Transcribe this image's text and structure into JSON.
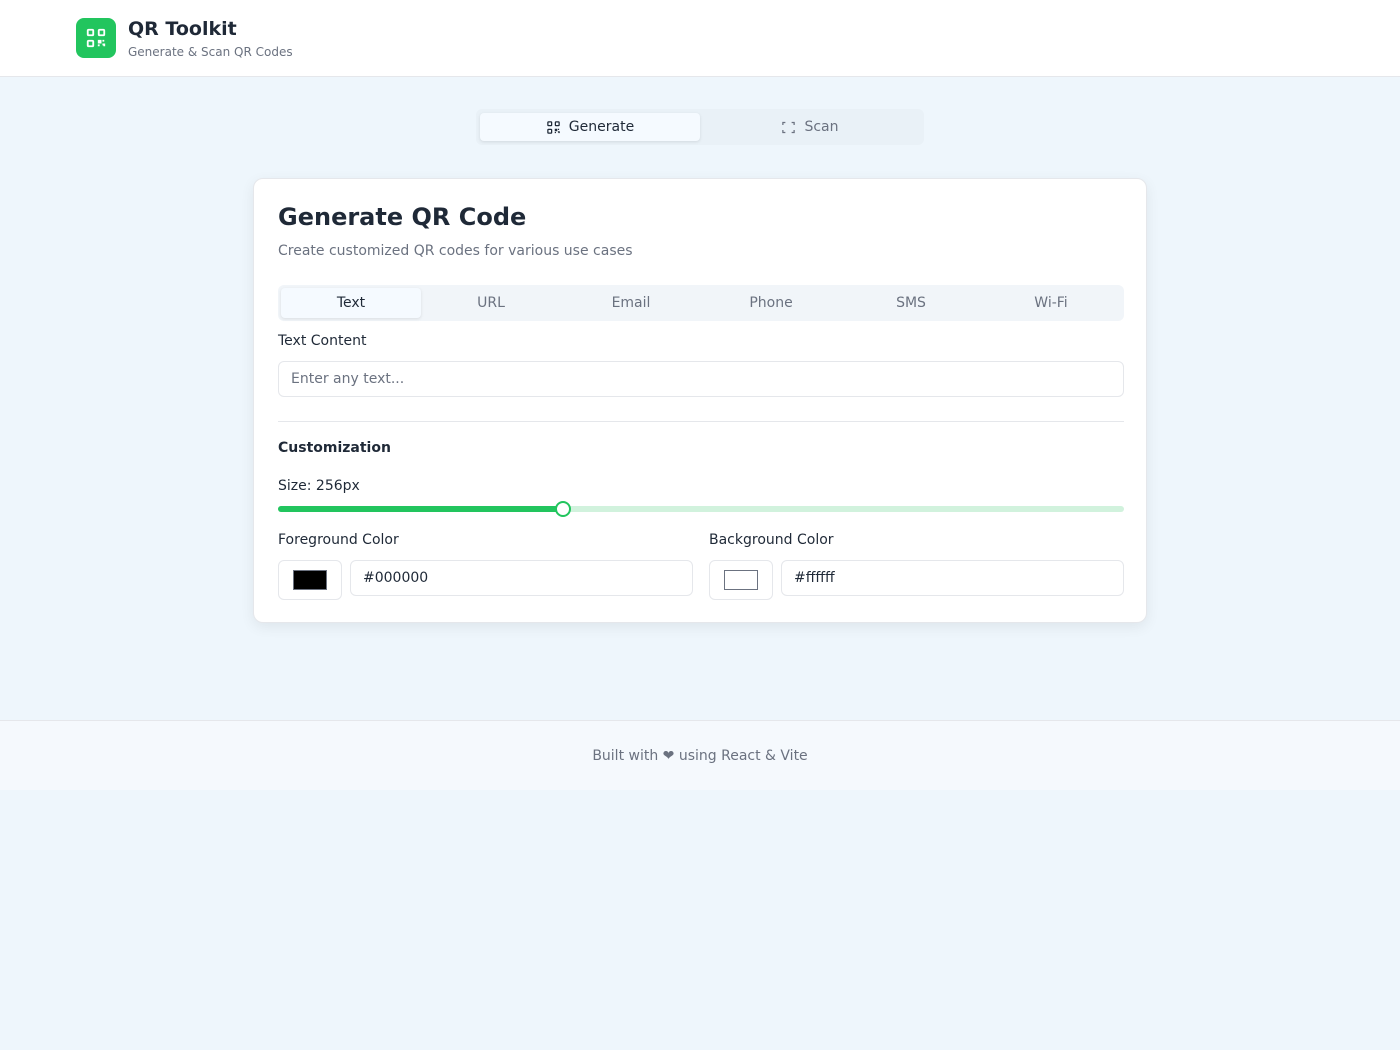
{
  "header": {
    "title": "QR Toolkit",
    "subtitle": "Generate & Scan QR Codes",
    "logo_icon": "qr-code-icon"
  },
  "main_tabs": [
    {
      "label": "Generate",
      "icon": "qr-code-icon",
      "active": true
    },
    {
      "label": "Scan",
      "icon": "scan-frame-icon",
      "active": false
    }
  ],
  "generator": {
    "title": "Generate QR Code",
    "description": "Create customized QR codes for various use cases",
    "type_tabs": [
      {
        "label": "Text",
        "active": true
      },
      {
        "label": "URL",
        "active": false
      },
      {
        "label": "Email",
        "active": false
      },
      {
        "label": "Phone",
        "active": false
      },
      {
        "label": "SMS",
        "active": false
      },
      {
        "label": "Wi-Fi",
        "active": false
      }
    ],
    "text_content": {
      "label": "Text Content",
      "value": "",
      "placeholder": "Enter any text..."
    },
    "customization": {
      "title": "Customization",
      "size_label": "Size: 256px",
      "size_fraction": 0.337,
      "foreground": {
        "label": "Foreground Color",
        "value": "#000000"
      },
      "background": {
        "label": "Background Color",
        "value": "#ffffff"
      }
    }
  },
  "footer": {
    "text": "Built with ❤ using React & Vite"
  },
  "colors": {
    "accent": "#22c55e",
    "page_background": "#eef6fc",
    "muted_text": "#6b7280"
  }
}
